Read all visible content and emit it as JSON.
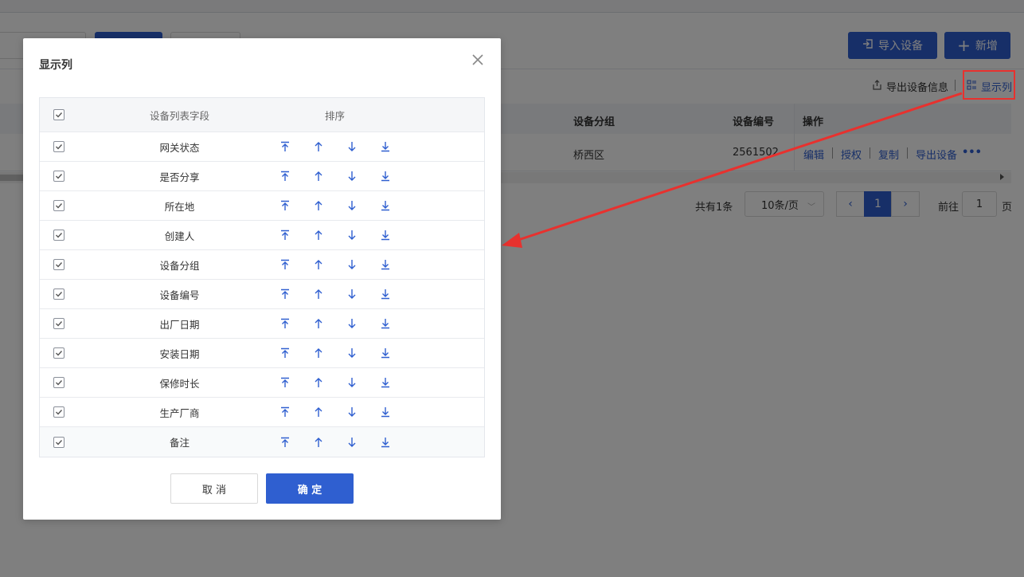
{
  "background": {
    "header_buttons": {
      "import_label": "导入设备",
      "add_label": "新增"
    },
    "toolbar": {
      "export_label": "导出设备信息",
      "columns_label": "显示列"
    },
    "table": {
      "headers": {
        "group": "设备分组",
        "number": "设备编号",
        "ops": "操作"
      },
      "row": {
        "group": "桥西区",
        "number": "2561502"
      },
      "ops": [
        "编辑",
        "授权",
        "复制",
        "导出设备",
        "•••"
      ]
    },
    "pagination": {
      "total": "共有1条",
      "page_size": "10条/页",
      "prev": "‹",
      "current": "1",
      "next": "›",
      "goto_prefix": "前往",
      "goto_value": "1",
      "goto_suffix": "页"
    }
  },
  "modal": {
    "title": "显示列",
    "header": {
      "field": "设备列表字段",
      "sort": "排序"
    },
    "rows": [
      {
        "label": "网关状态"
      },
      {
        "label": "是否分享"
      },
      {
        "label": "所在地"
      },
      {
        "label": "创建人"
      },
      {
        "label": "设备分组"
      },
      {
        "label": "设备编号"
      },
      {
        "label": "出厂日期"
      },
      {
        "label": "安装日期"
      },
      {
        "label": "保修时长"
      },
      {
        "label": "生产厂商"
      },
      {
        "label": "备注"
      }
    ],
    "cancel_label": "取 消",
    "ok_label": "确 定"
  },
  "colors": {
    "primary": "#2f5fd0",
    "highlight": "#e8312e"
  }
}
